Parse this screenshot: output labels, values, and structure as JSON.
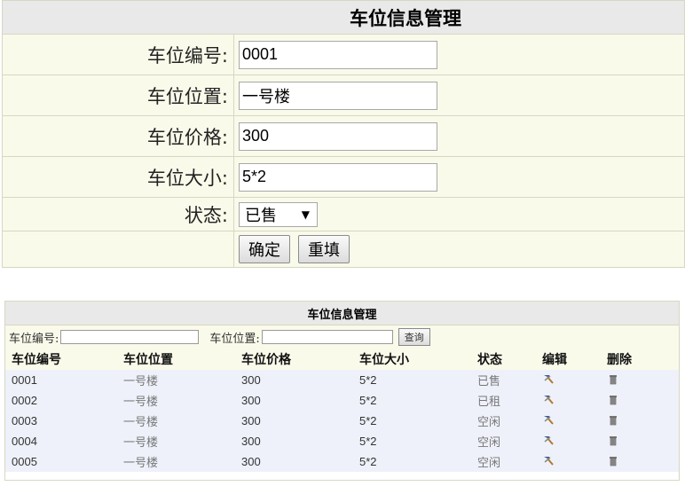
{
  "form": {
    "title": "车位信息管理",
    "fields": [
      {
        "label": "车位编号:",
        "value": "0001"
      },
      {
        "label": "车位位置:",
        "value": "一号楼"
      },
      {
        "label": "车位价格:",
        "value": "300"
      },
      {
        "label": "车位大小:",
        "value": "5*2"
      }
    ],
    "status_label": "状态:",
    "status_value": "已售",
    "confirm_label": "确定",
    "reset_label": "重填"
  },
  "list": {
    "title": "车位信息管理",
    "search": {
      "number_label": "车位编号:",
      "location_label": "车位位置:",
      "query_label": "查询"
    },
    "columns": [
      "车位编号",
      "车位位置",
      "车位价格",
      "车位大小",
      "状态",
      "编辑",
      "删除"
    ],
    "rows": [
      {
        "number": "0001",
        "location": "一号楼",
        "price": "300",
        "size": "5*2",
        "status": "已售"
      },
      {
        "number": "0002",
        "location": "一号楼",
        "price": "300",
        "size": "5*2",
        "status": "已租"
      },
      {
        "number": "0003",
        "location": "一号楼",
        "price": "300",
        "size": "5*2",
        "status": "空闲"
      },
      {
        "number": "0004",
        "location": "一号楼",
        "price": "300",
        "size": "5*2",
        "status": "空闲"
      },
      {
        "number": "0005",
        "location": "一号楼",
        "price": "300",
        "size": "5*2",
        "status": "空闲"
      }
    ]
  },
  "icons": {
    "edit": "edit-hammer-icon",
    "delete": "trash-icon"
  },
  "colors": {
    "title_bg": "#e9e9e9",
    "row_bg": "#fafaeb",
    "data_row_bg": "#eef1fa",
    "border": "#d7d7c2"
  }
}
